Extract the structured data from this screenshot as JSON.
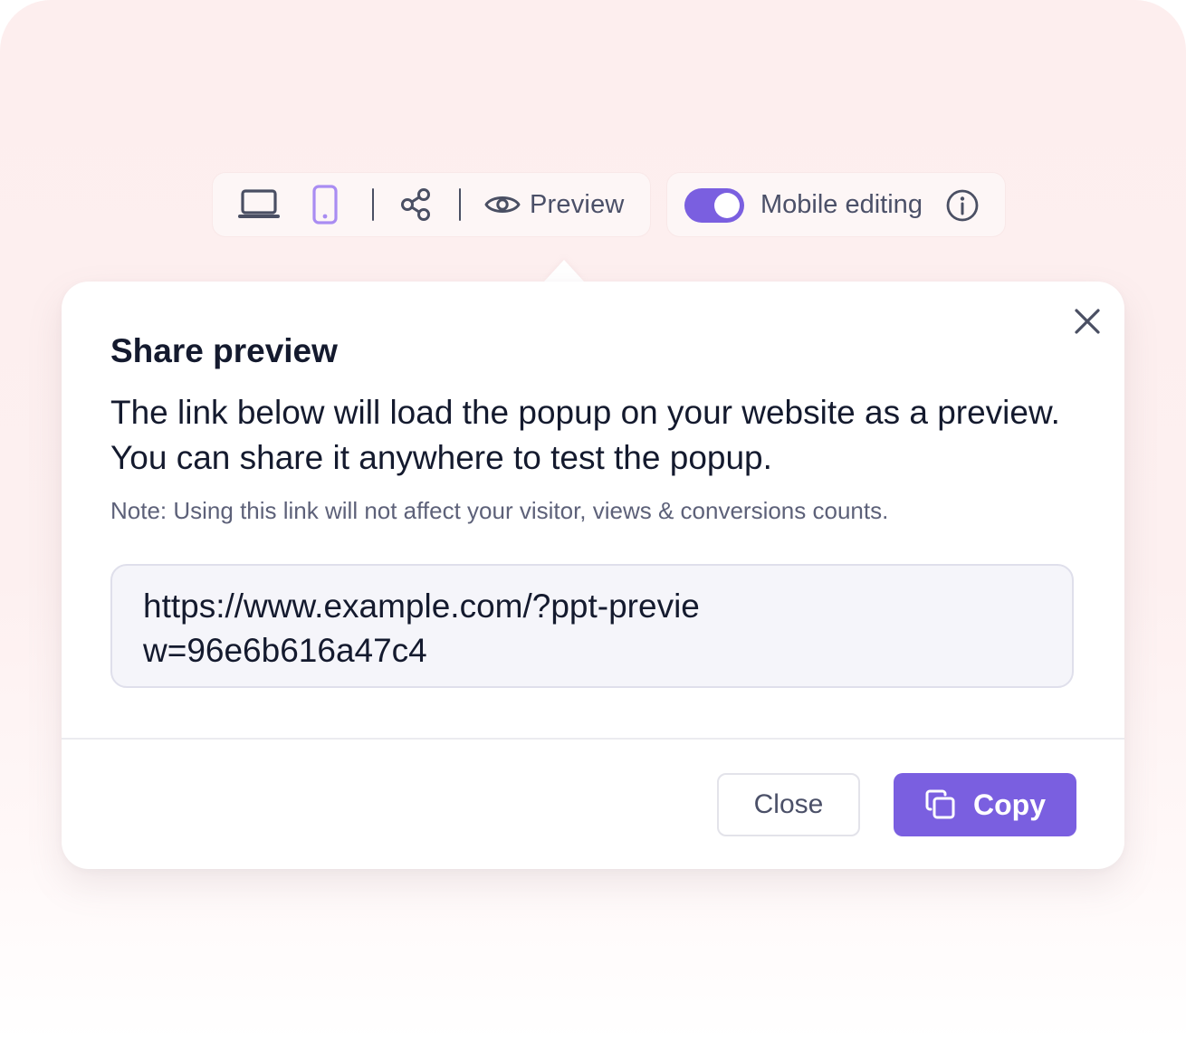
{
  "toolbar": {
    "devices": [
      {
        "icon": "laptop-icon",
        "active": false
      },
      {
        "icon": "mobile-icon",
        "active": true
      }
    ],
    "share_icon": "share-icon",
    "preview_icon": "eye-icon",
    "preview_label": "Preview",
    "mobile_editing": {
      "label": "Mobile editing",
      "enabled": true,
      "info_icon": "info-icon"
    }
  },
  "modal": {
    "title": "Share preview",
    "description": "The link below will load the popup on your website as a preview. You can share it anywhere to test the popup.",
    "note": "Note: Using this link will not affect your visitor, views & conversions counts.",
    "url": "https://www.example.com/?ppt-preview=96e6b616a47c4",
    "close_icon": "close-icon",
    "close_label": "Close",
    "copy_label": "Copy",
    "copy_icon": "copy-icon"
  },
  "colors": {
    "accent": "#7a5fe0",
    "accent_light": "#a98cf2",
    "text_dark": "#141a2e",
    "text_muted": "#4b5068",
    "background": "#fdeeee"
  }
}
